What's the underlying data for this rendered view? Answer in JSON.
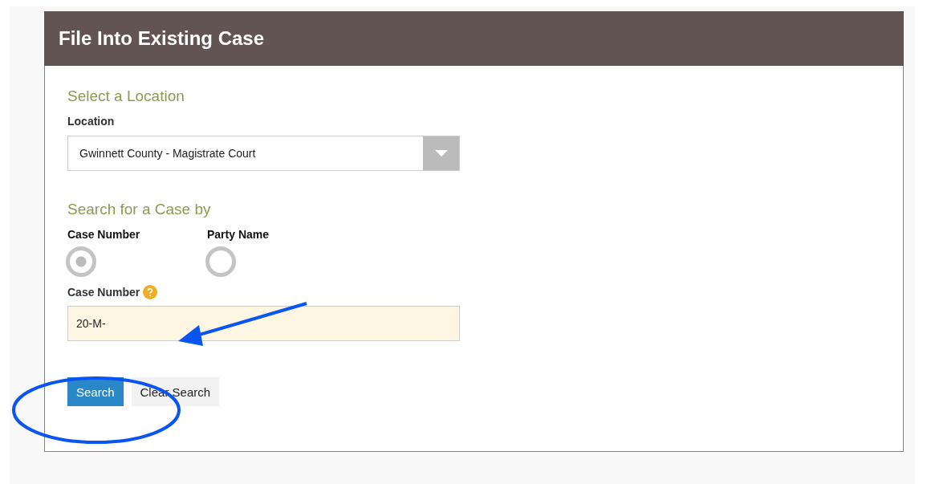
{
  "panel": {
    "title": "File Into Existing Case"
  },
  "location_section": {
    "heading": "Select a Location",
    "label": "Location",
    "select": {
      "value": "Gwinnett County - Magistrate Court"
    }
  },
  "search_section": {
    "heading": "Search for a Case by",
    "options": [
      {
        "label": "Case Number",
        "selected": true
      },
      {
        "label": "Party Name",
        "selected": false
      }
    ],
    "field": {
      "label": "Case Number",
      "value": "20-M-"
    }
  },
  "buttons": [
    {
      "label": "Search",
      "kind": "primary"
    },
    {
      "label": "Clear Search",
      "kind": "secondary"
    }
  ],
  "annotations": [
    {
      "kind": "arrow"
    },
    {
      "kind": "ellipse"
    }
  ]
}
